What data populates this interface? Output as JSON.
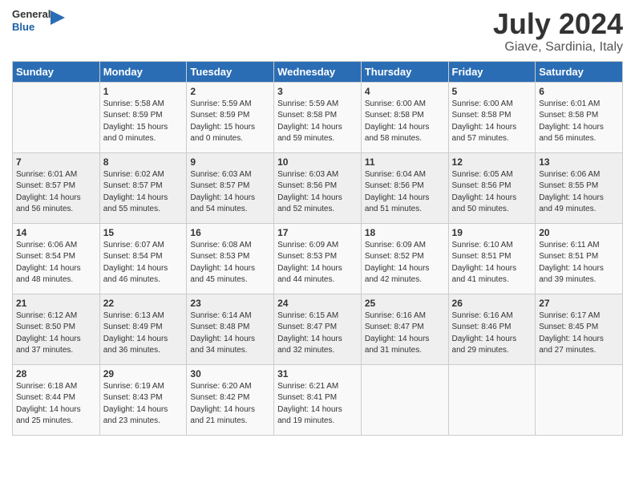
{
  "header": {
    "logo_general": "General",
    "logo_blue": "Blue",
    "month_year": "July 2024",
    "location": "Giave, Sardinia, Italy"
  },
  "days_of_week": [
    "Sunday",
    "Monday",
    "Tuesday",
    "Wednesday",
    "Thursday",
    "Friday",
    "Saturday"
  ],
  "weeks": [
    [
      {
        "day": "",
        "info": ""
      },
      {
        "day": "1",
        "info": "Sunrise: 5:58 AM\nSunset: 8:59 PM\nDaylight: 15 hours\nand 0 minutes."
      },
      {
        "day": "2",
        "info": "Sunrise: 5:59 AM\nSunset: 8:59 PM\nDaylight: 15 hours\nand 0 minutes."
      },
      {
        "day": "3",
        "info": "Sunrise: 5:59 AM\nSunset: 8:58 PM\nDaylight: 14 hours\nand 59 minutes."
      },
      {
        "day": "4",
        "info": "Sunrise: 6:00 AM\nSunset: 8:58 PM\nDaylight: 14 hours\nand 58 minutes."
      },
      {
        "day": "5",
        "info": "Sunrise: 6:00 AM\nSunset: 8:58 PM\nDaylight: 14 hours\nand 57 minutes."
      },
      {
        "day": "6",
        "info": "Sunrise: 6:01 AM\nSunset: 8:58 PM\nDaylight: 14 hours\nand 56 minutes."
      }
    ],
    [
      {
        "day": "7",
        "info": "Sunrise: 6:01 AM\nSunset: 8:57 PM\nDaylight: 14 hours\nand 56 minutes."
      },
      {
        "day": "8",
        "info": "Sunrise: 6:02 AM\nSunset: 8:57 PM\nDaylight: 14 hours\nand 55 minutes."
      },
      {
        "day": "9",
        "info": "Sunrise: 6:03 AM\nSunset: 8:57 PM\nDaylight: 14 hours\nand 54 minutes."
      },
      {
        "day": "10",
        "info": "Sunrise: 6:03 AM\nSunset: 8:56 PM\nDaylight: 14 hours\nand 52 minutes."
      },
      {
        "day": "11",
        "info": "Sunrise: 6:04 AM\nSunset: 8:56 PM\nDaylight: 14 hours\nand 51 minutes."
      },
      {
        "day": "12",
        "info": "Sunrise: 6:05 AM\nSunset: 8:56 PM\nDaylight: 14 hours\nand 50 minutes."
      },
      {
        "day": "13",
        "info": "Sunrise: 6:06 AM\nSunset: 8:55 PM\nDaylight: 14 hours\nand 49 minutes."
      }
    ],
    [
      {
        "day": "14",
        "info": "Sunrise: 6:06 AM\nSunset: 8:54 PM\nDaylight: 14 hours\nand 48 minutes."
      },
      {
        "day": "15",
        "info": "Sunrise: 6:07 AM\nSunset: 8:54 PM\nDaylight: 14 hours\nand 46 minutes."
      },
      {
        "day": "16",
        "info": "Sunrise: 6:08 AM\nSunset: 8:53 PM\nDaylight: 14 hours\nand 45 minutes."
      },
      {
        "day": "17",
        "info": "Sunrise: 6:09 AM\nSunset: 8:53 PM\nDaylight: 14 hours\nand 44 minutes."
      },
      {
        "day": "18",
        "info": "Sunrise: 6:09 AM\nSunset: 8:52 PM\nDaylight: 14 hours\nand 42 minutes."
      },
      {
        "day": "19",
        "info": "Sunrise: 6:10 AM\nSunset: 8:51 PM\nDaylight: 14 hours\nand 41 minutes."
      },
      {
        "day": "20",
        "info": "Sunrise: 6:11 AM\nSunset: 8:51 PM\nDaylight: 14 hours\nand 39 minutes."
      }
    ],
    [
      {
        "day": "21",
        "info": "Sunrise: 6:12 AM\nSunset: 8:50 PM\nDaylight: 14 hours\nand 37 minutes."
      },
      {
        "day": "22",
        "info": "Sunrise: 6:13 AM\nSunset: 8:49 PM\nDaylight: 14 hours\nand 36 minutes."
      },
      {
        "day": "23",
        "info": "Sunrise: 6:14 AM\nSunset: 8:48 PM\nDaylight: 14 hours\nand 34 minutes."
      },
      {
        "day": "24",
        "info": "Sunrise: 6:15 AM\nSunset: 8:47 PM\nDaylight: 14 hours\nand 32 minutes."
      },
      {
        "day": "25",
        "info": "Sunrise: 6:16 AM\nSunset: 8:47 PM\nDaylight: 14 hours\nand 31 minutes."
      },
      {
        "day": "26",
        "info": "Sunrise: 6:16 AM\nSunset: 8:46 PM\nDaylight: 14 hours\nand 29 minutes."
      },
      {
        "day": "27",
        "info": "Sunrise: 6:17 AM\nSunset: 8:45 PM\nDaylight: 14 hours\nand 27 minutes."
      }
    ],
    [
      {
        "day": "28",
        "info": "Sunrise: 6:18 AM\nSunset: 8:44 PM\nDaylight: 14 hours\nand 25 minutes."
      },
      {
        "day": "29",
        "info": "Sunrise: 6:19 AM\nSunset: 8:43 PM\nDaylight: 14 hours\nand 23 minutes."
      },
      {
        "day": "30",
        "info": "Sunrise: 6:20 AM\nSunset: 8:42 PM\nDaylight: 14 hours\nand 21 minutes."
      },
      {
        "day": "31",
        "info": "Sunrise: 6:21 AM\nSunset: 8:41 PM\nDaylight: 14 hours\nand 19 minutes."
      },
      {
        "day": "",
        "info": ""
      },
      {
        "day": "",
        "info": ""
      },
      {
        "day": "",
        "info": ""
      }
    ]
  ]
}
